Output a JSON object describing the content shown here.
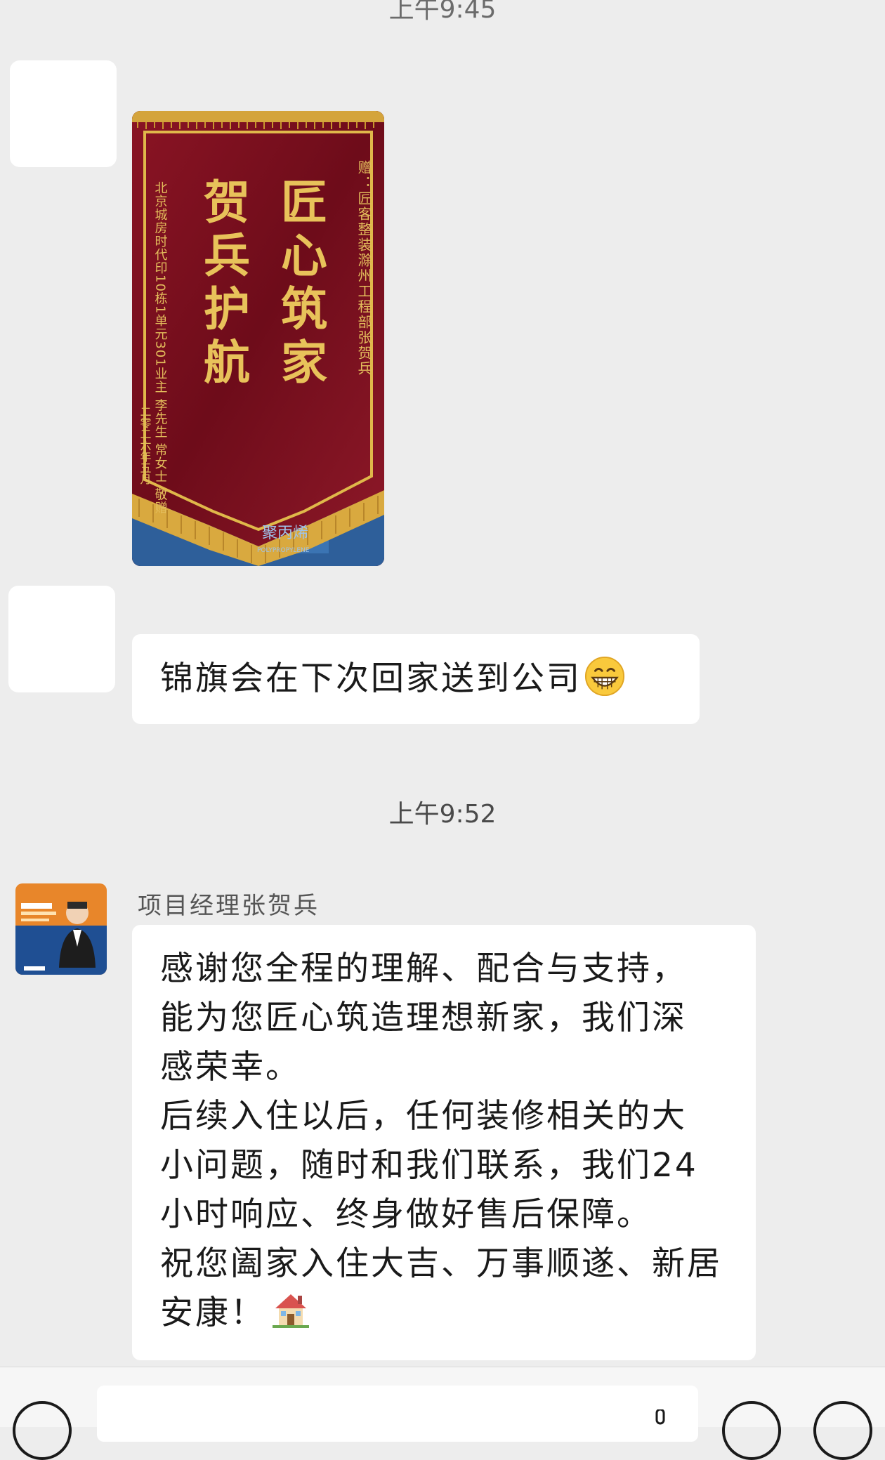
{
  "chat": {
    "top_timestamp": "上午9:45",
    "mid_timestamp": "上午9:52"
  },
  "banner": {
    "gift_line": "赠：匠客整装滁州工程部张贺兵",
    "slogan_col1": "匠心筑家",
    "slogan_col2": "贺兵护航",
    "donor_line": "北京城房时代印10栋1单元301业主 李先生 常女士 敬赠",
    "date_line": "二零二六年五月",
    "wall_label": "聚丙烯",
    "wall_sub": "POLYPROPYLENE"
  },
  "messages": [
    {
      "id": "msg1",
      "text": "锦旗会在下次回家送到公司",
      "emoji": "grinning-face"
    },
    {
      "id": "msg2",
      "sender": "项目经理张贺兵",
      "lines": [
        "感谢您全程的理解、配合与支持，",
        "能为您匠心筑造理想新家，我们深",
        "感荣幸。",
        "后续入住以后，任何装修相关的大",
        "小问题，随时和我们联系，我们24",
        "小时响应、终身做好售后保障。",
        "祝您阖家入住大吉、万事顺遂、新居",
        "安康！"
      ],
      "emoji": "house"
    }
  ],
  "colors": {
    "background": "#ededed",
    "bubble": "#ffffff",
    "banner_red": "#7a0f1f",
    "banner_gold": "#e0b84a"
  }
}
